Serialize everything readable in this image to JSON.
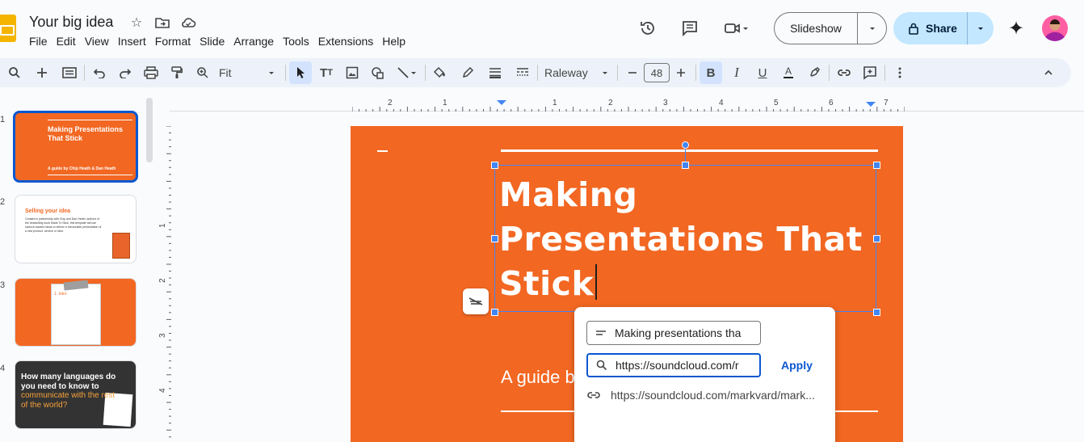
{
  "app": {
    "title": "Your big idea",
    "menu": [
      "File",
      "Edit",
      "View",
      "Insert",
      "Format",
      "Slide",
      "Arrange",
      "Tools",
      "Extensions",
      "Help"
    ]
  },
  "header": {
    "slideshow_label": "Slideshow",
    "share_label": "Share"
  },
  "toolbar": {
    "zoom_value": "Fit",
    "font_name": "Raleway",
    "font_size": "48"
  },
  "ruler": {
    "h_labels": [
      "2",
      "1",
      "1",
      "2",
      "3",
      "4",
      "5",
      "6",
      "7"
    ],
    "v_labels": [
      "1",
      "2",
      "3",
      "4"
    ]
  },
  "filmstrip": {
    "slides": [
      {
        "number": "1",
        "title": "Making Presentations That Stick",
        "subtitle": "A guide by Chip Heath & Dan Heath"
      },
      {
        "number": "2",
        "title": "Selling your idea",
        "body": "Created in partnership with Chip and Dan Heath, authors of the bestselling book Made To Stick, this template will use science-backed ideas to deliver a memorable presentation of a new product, service or idea."
      },
      {
        "number": "3",
        "title": "1. Intro"
      },
      {
        "number": "4",
        "title_part1": "How many languages do you need to know to",
        "title_part2": "communicate with the rest of the world?"
      }
    ]
  },
  "slide": {
    "title_line1": "Making",
    "title_line2": "Presentations That",
    "title_line3": "Stick",
    "subtitle": "A guide b"
  },
  "link_popup": {
    "text_value": "Making presentations tha",
    "url_value": "https://soundcloud.com/r",
    "apply_label": "Apply",
    "suggestion": "https://soundcloud.com/markvard/mark..."
  },
  "colors": {
    "slide_bg": "#f26722",
    "accent": "#0b57d0",
    "share_bg": "#c2e7ff"
  }
}
